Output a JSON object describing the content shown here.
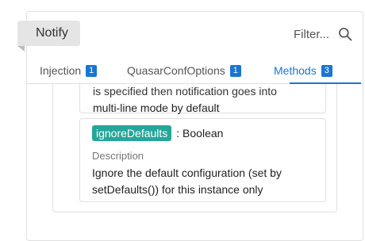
{
  "header": {
    "ribbon_label": "Notify",
    "filter_placeholder": "Filter..."
  },
  "tabs": [
    {
      "label": "Injection",
      "count": "1",
      "active": false
    },
    {
      "label": "QuasarConfOptions",
      "count": "1",
      "active": false
    },
    {
      "label": "Methods",
      "count": "3",
      "active": true
    }
  ],
  "previous_item": {
    "line1": "is specified then notification goes into",
    "line2": "multi-line mode by default"
  },
  "item": {
    "name": "ignoreDefaults",
    "type": ": Boolean",
    "description_label": "Description",
    "description_line1": "Ignore the default configuration (set by",
    "description_line2": "setDefaults()) for this instance only"
  },
  "colors": {
    "accent": "#1976d2",
    "prop_badge": "#26a69a"
  }
}
